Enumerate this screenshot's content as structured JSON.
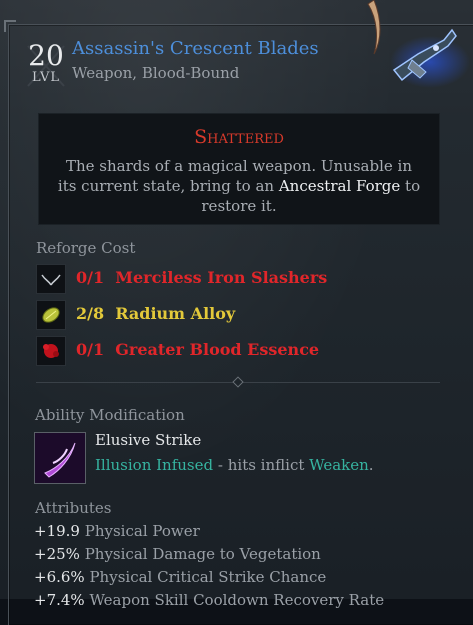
{
  "item": {
    "level": "20",
    "level_label": "LVL",
    "name": "Assassin's Crescent Blades",
    "type": "Weapon, Blood-Bound"
  },
  "shattered": {
    "title": "Shattered",
    "desc_before": "The shards of a magical weapon. Unusable in its current state, bring to an ",
    "highlight": "Ancestral Forge",
    "desc_after": " to restore it."
  },
  "reforge": {
    "label": "Reforge Cost",
    "items": [
      {
        "count": "0/1",
        "name": "Merciless Iron Slashers",
        "color": "#e0262a",
        "icon": "iron-slashers-icon"
      },
      {
        "count": "2/8",
        "name": "Radium Alloy",
        "color": "#e3c93a",
        "icon": "radium-alloy-icon"
      },
      {
        "count": "0/1",
        "name": "Greater Blood Essence",
        "color": "#e0262a",
        "icon": "blood-essence-icon"
      }
    ]
  },
  "ability": {
    "label": "Ability Modification",
    "name": "Elusive Strike",
    "mod": "Illusion Infused",
    "mid": " - hits inflict ",
    "effect": "Weaken",
    "end": "."
  },
  "attributes": {
    "label": "Attributes",
    "items": [
      {
        "value": "+19.9",
        "name": "Physical Power"
      },
      {
        "value": "+25%",
        "name": "Physical Damage to Vegetation"
      },
      {
        "value": "+6.6%",
        "name": "Physical Critical Strike Chance"
      },
      {
        "value": "+7.4%",
        "name": "Weapon Skill Cooldown Recovery Rate"
      }
    ]
  }
}
